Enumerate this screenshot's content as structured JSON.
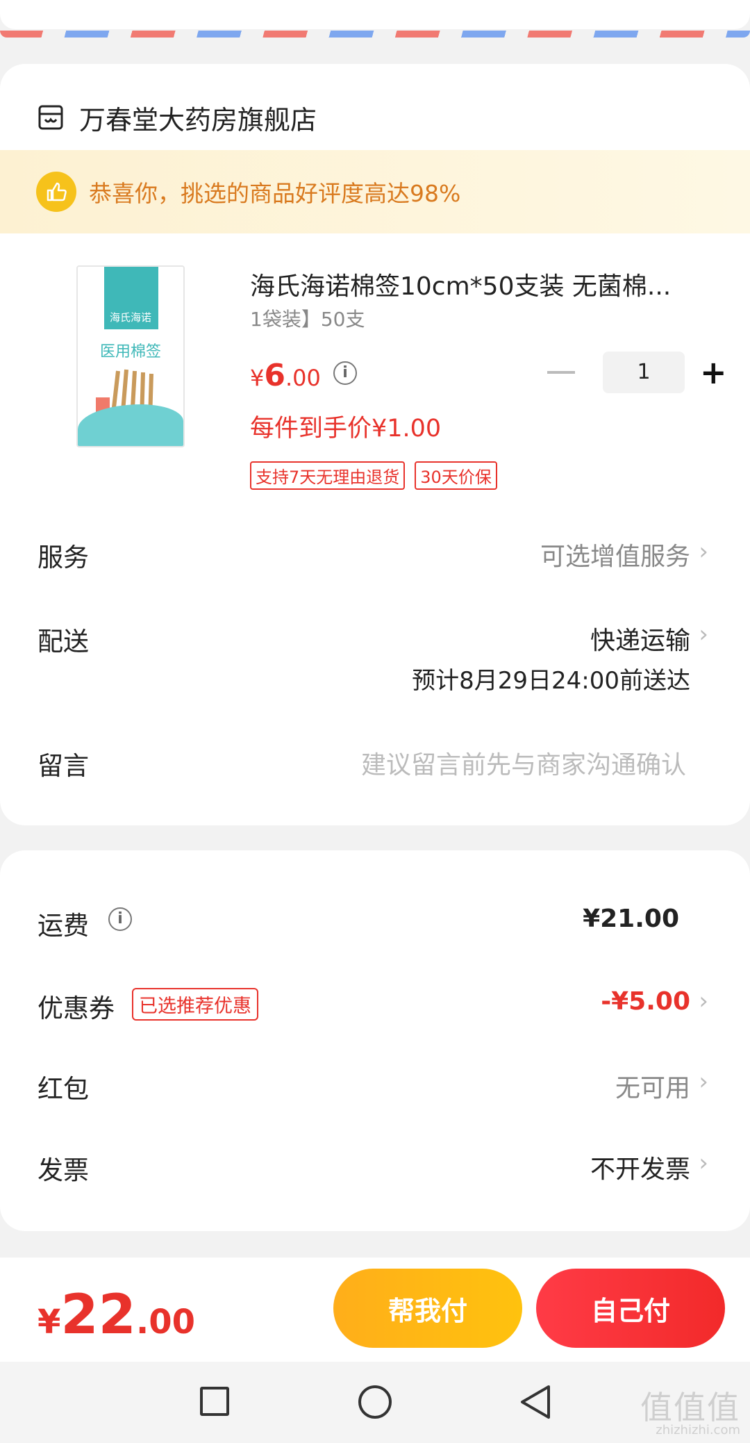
{
  "shop": {
    "name": "万春堂大药房旗舰店"
  },
  "notice": {
    "text": "恭喜你，挑选的商品好评度高达98%"
  },
  "product": {
    "image_brand": "海氏海诺",
    "image_category": "医用棉签",
    "title": "海氏海诺棉签10cm*50支装 无菌棉...",
    "spec": "1袋装】50支",
    "price_currency": "¥",
    "price_integer": "6",
    "price_decimal": ".00",
    "unit_price": "每件到手价¥1.00",
    "quantity": "1",
    "minus_symbol": "−",
    "plus_symbol": "+",
    "tags": [
      "支持7天无理由退货",
      "30天价保"
    ]
  },
  "rows": {
    "service": {
      "label": "服务",
      "value": "可选增值服务"
    },
    "delivery": {
      "label": "配送",
      "value": "快递运输",
      "eta": "预计8月29日24:00前送达"
    },
    "message": {
      "label": "留言",
      "placeholder": "建议留言前先与商家沟通确认"
    }
  },
  "fees": {
    "shipping": {
      "label": "运费",
      "value": "¥21.00"
    },
    "coupon": {
      "label": "优惠券",
      "tag": "已选推荐优惠",
      "value": "-¥5.00"
    },
    "red_packet": {
      "label": "红包",
      "value": "无可用"
    },
    "invoice": {
      "label": "发票",
      "value": "不开发票"
    }
  },
  "footer": {
    "total_currency": "¥",
    "total_integer": "22",
    "total_decimal": ".00",
    "help_pay_label": "帮我付",
    "self_pay_label": "自己付"
  },
  "watermark": {
    "main": "值值值",
    "sub": "zhizhizhi.com"
  },
  "colors": {
    "accent_red": "#e8322b",
    "help_button": "#ffb814",
    "notice_bg": "#fdf1d2",
    "notice_text": "#d97a1f"
  }
}
